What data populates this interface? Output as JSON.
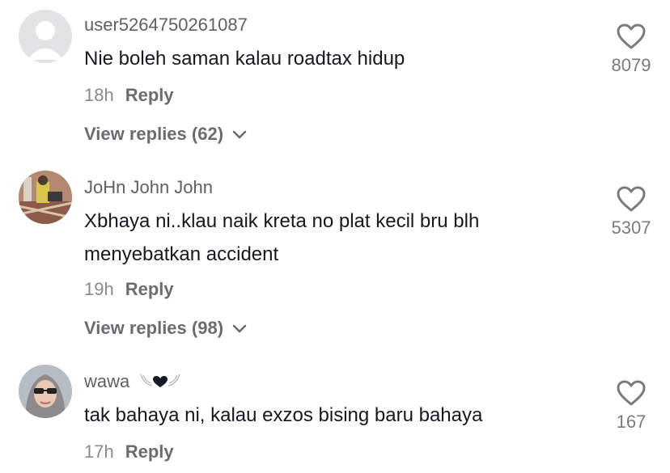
{
  "comments": [
    {
      "username": "user5264750261087",
      "text": "Nie boleh saman kalau roadtax hidup",
      "time": "18h",
      "reply_label": "Reply",
      "view_replies": "View replies (62)",
      "likes": "8079",
      "avatar": "default-avatar-icon"
    },
    {
      "username": "JoHn John John",
      "text": "Xbhaya ni..klau naik kreta no plat kecil bru blh menyebatkan accident",
      "time": "19h",
      "reply_label": "Reply",
      "view_replies": "View replies (98)",
      "likes": "5307",
      "avatar": "photo-avatar"
    },
    {
      "username": "wawa",
      "username_decoration": "wing-heart-icon",
      "text": "tak bahaya ni, kalau exzos bising baru bahaya",
      "time": "17h",
      "reply_label": "Reply",
      "likes": "167",
      "avatar": "photo-avatar"
    }
  ],
  "colors": {
    "text": "#161823",
    "secondary": "#8a8b91",
    "icon": "#7a7b81"
  }
}
